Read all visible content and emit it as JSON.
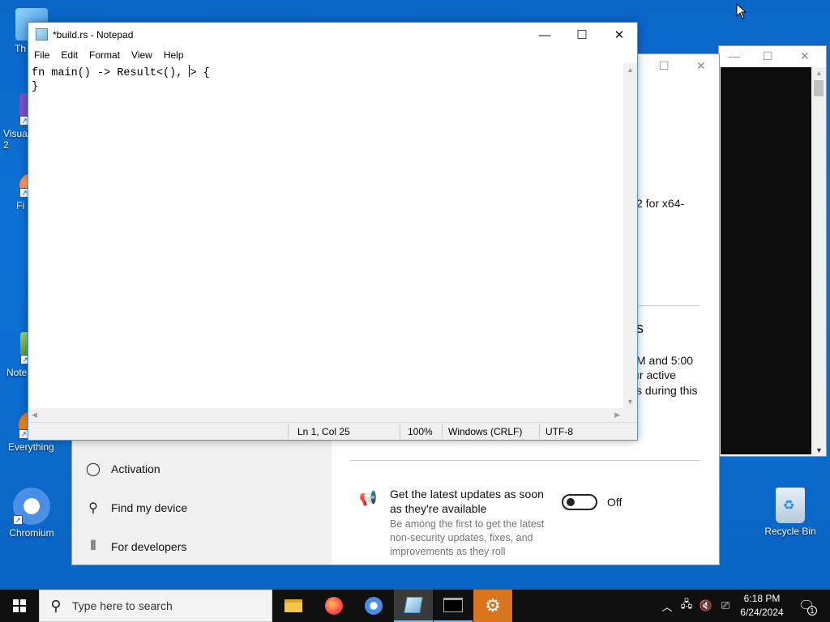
{
  "desktop": {
    "icons": [
      {
        "label": "Th"
      },
      {
        "label": "Visua\n2"
      },
      {
        "label": "Fi"
      },
      {
        "label": "Note"
      },
      {
        "label": "Everything"
      },
      {
        "label": "Chromium"
      },
      {
        "label": "Recycle Bin"
      }
    ]
  },
  "notepad": {
    "title": "*build.rs - Notepad",
    "menu": [
      "File",
      "Edit",
      "Format",
      "View",
      "Help"
    ],
    "line1_before_caret": "fn main() -> Result<(), ",
    "line1_after_caret": "> {",
    "line2": "}",
    "status": {
      "position": "Ln 1, Col 25",
      "zoom": "100%",
      "line_ending": "Windows (CRLF)",
      "encoding": "UTF-8"
    }
  },
  "settings": {
    "nav": [
      {
        "label": "Activation"
      },
      {
        "label": "Find my device"
      },
      {
        "label": "For developers"
      }
    ],
    "fragment_arch": "2 for x64-",
    "fragment_s": "s",
    "fragment_hours_1": "M and 5:00",
    "fragment_hours_2": "ır active",
    "fragment_hours_3": "s during this",
    "updates_title": "Get the latest updates as soon as they're available",
    "updates_desc": "Be among the first to get the latest non-security updates, fixes, and improvements as they roll",
    "toggle_label": "Off"
  },
  "taskbar": {
    "search_placeholder": "Type here to search",
    "time": "6:18 PM",
    "date": "6/24/2024",
    "notification_count": "1"
  }
}
